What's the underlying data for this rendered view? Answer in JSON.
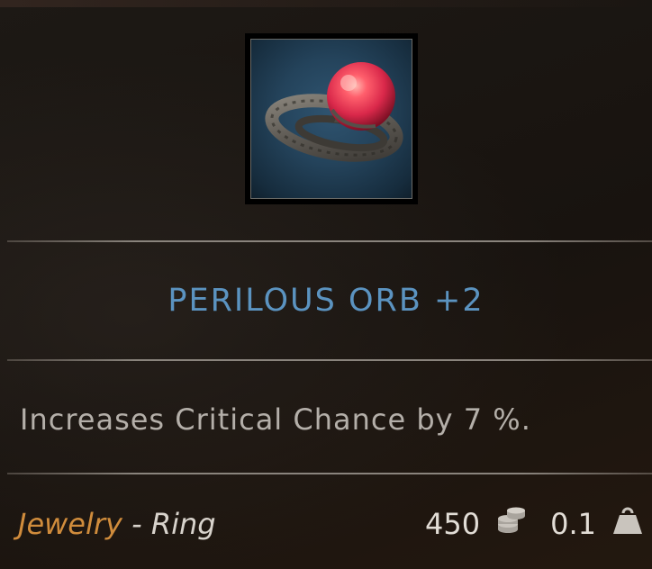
{
  "item": {
    "name": "PERILOUS ORB +2",
    "description": "Increases Critical Chance by 7 %.",
    "category": "Jewelry",
    "separator": " - ",
    "subtype": "Ring",
    "price": "450",
    "weight": "0.1"
  },
  "icons": {
    "item_image": "ring-with-red-orb",
    "price_icon": "coins-stack-icon",
    "weight_icon": "weight-icon"
  },
  "colors": {
    "name": "#5b93c0",
    "category": "#d08c3c",
    "description": "#b4afa9"
  }
}
